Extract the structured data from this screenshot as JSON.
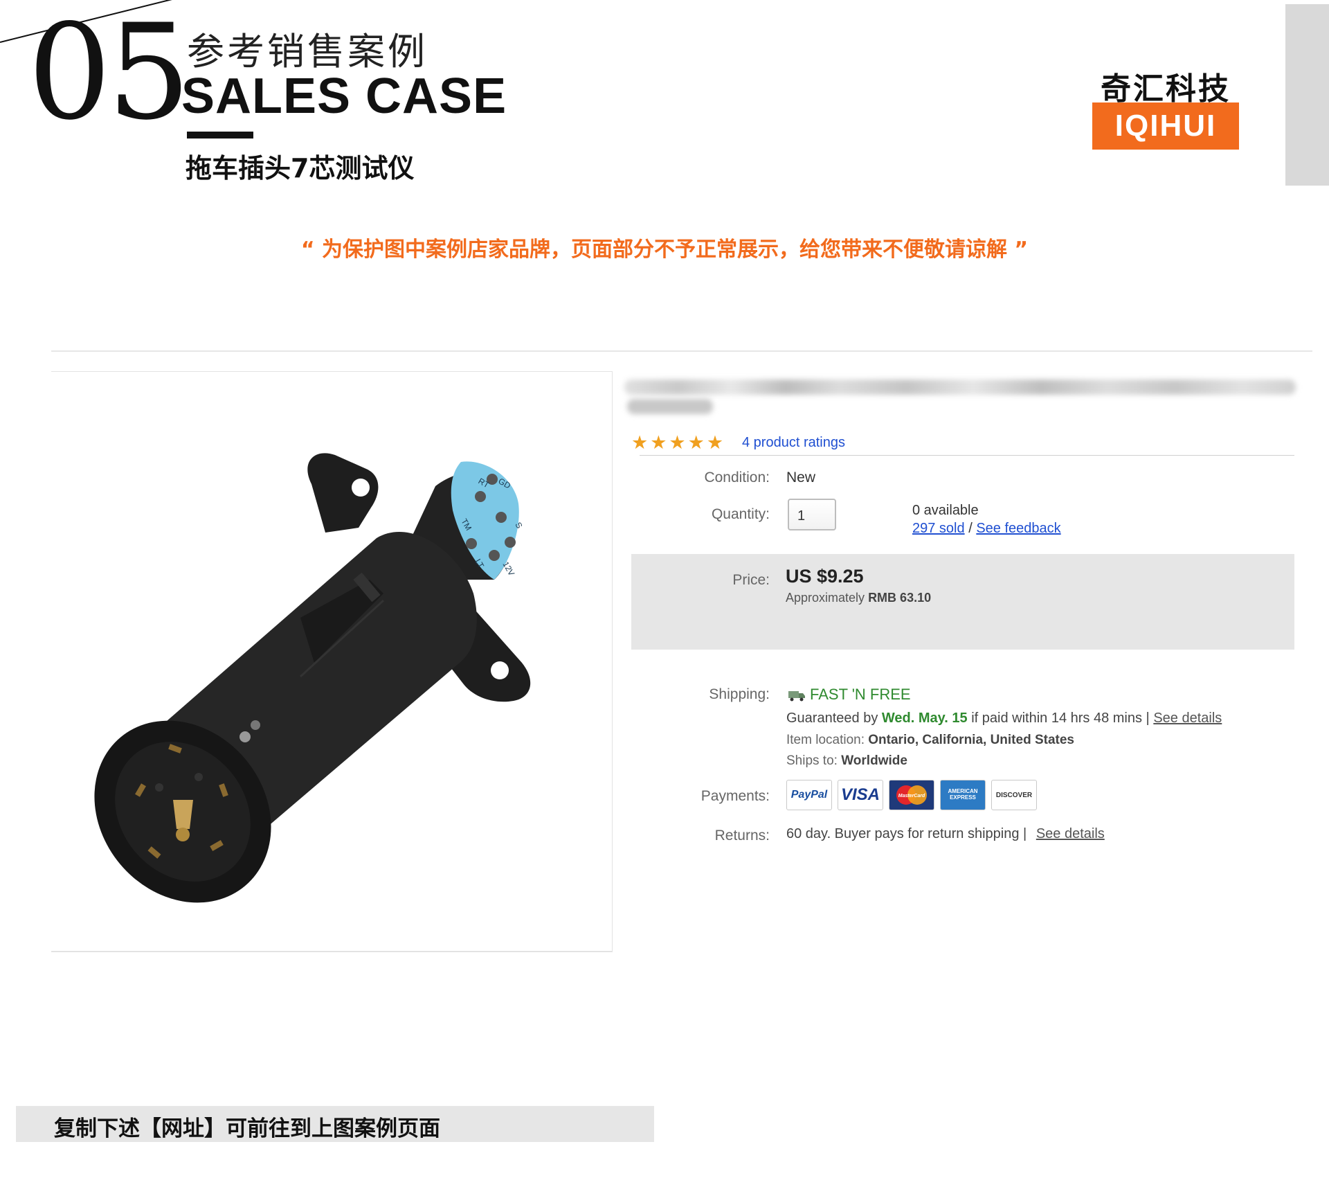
{
  "header": {
    "number": "05",
    "title_cn": "参考销售案例",
    "title_en": "SALES CASE",
    "subtitle": "拖车插头7芯测试仪",
    "brand_cn": "奇汇科技",
    "brand_en": "IQIHUI"
  },
  "notice": "“ 为保护图中案例店家品牌，页面部分不予正常展示，给您带来不便敬请谅解 ”",
  "listing": {
    "product_image_labels": [
      "RT",
      "GD",
      "TM",
      "S",
      "LT",
      "12V"
    ],
    "stars": "★★★★★",
    "ratings_link": "4 product ratings",
    "condition_label": "Condition:",
    "condition_value": "New",
    "quantity_label": "Quantity:",
    "quantity_value": "1",
    "available": "0 available",
    "sold_link": "297 sold",
    "separator": "/",
    "feedback_link": "See feedback",
    "price_label": "Price:",
    "price_value": "US $9.25",
    "approx_prefix": "Approximately",
    "approx_value": "RMB 63.10",
    "shipping_label": "Shipping:",
    "shipping_free": "FAST 'N FREE",
    "guaranteed_prefix": "Guaranteed by",
    "guaranteed_date": "Wed. May. 15",
    "guaranteed_suffix": "if paid within 14 hrs 48 mins |",
    "shipping_details_link": "See details",
    "item_location_label": "Item location:",
    "item_location_value": "Ontario, California, United States",
    "ships_to_label": "Ships to:",
    "ships_to_value": "Worldwide",
    "payments_label": "Payments:",
    "payments": [
      "PayPal",
      "VISA",
      "MasterCard",
      "AMERICAN EXPRESS",
      "DISCOVER"
    ],
    "returns_label": "Returns:",
    "returns_value": "60 day. Buyer pays for return shipping |",
    "returns_details_link": "See details"
  },
  "footer": {
    "text": "复制下述【网址】可前往到上图案例页面"
  },
  "colors": {
    "accent_orange": "#f26b1d",
    "link_blue": "#1f4fd1",
    "star_orange": "#f0a020",
    "ship_green": "#2f8a2f",
    "panel_gray": "#e6e6e6"
  }
}
